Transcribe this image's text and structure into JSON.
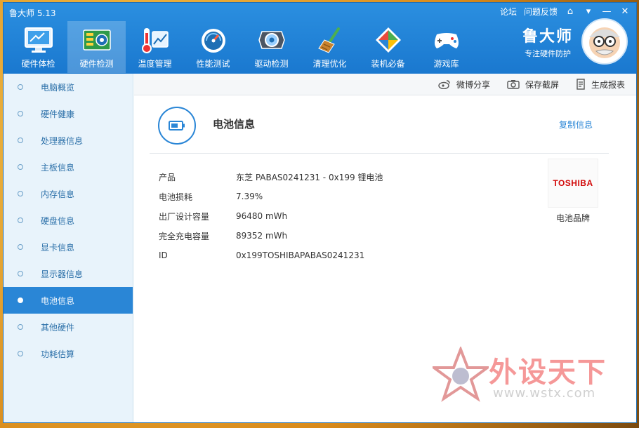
{
  "app": {
    "title": "鲁大师 5.13"
  },
  "window_links": {
    "forum": "论坛",
    "feedback": "问题反馈"
  },
  "toolbar": {
    "items": [
      {
        "label": "硬件体检",
        "icon": "monitor-icon"
      },
      {
        "label": "硬件检测",
        "icon": "circuit-board-icon",
        "active": true
      },
      {
        "label": "温度管理",
        "icon": "thermometer-icon"
      },
      {
        "label": "性能测试",
        "icon": "speedometer-icon"
      },
      {
        "label": "驱动检测",
        "icon": "gear-box-icon"
      },
      {
        "label": "清理优化",
        "icon": "broom-icon"
      },
      {
        "label": "装机必备",
        "icon": "install-cube-icon"
      },
      {
        "label": "游戏库",
        "icon": "gamepad-icon"
      }
    ]
  },
  "brand": {
    "name": "鲁大师",
    "slogan": "专注硬件防护"
  },
  "sidebar": {
    "items": [
      {
        "label": "电脑概览"
      },
      {
        "label": "硬件健康"
      },
      {
        "label": "处理器信息"
      },
      {
        "label": "主板信息"
      },
      {
        "label": "内存信息"
      },
      {
        "label": "硬盘信息"
      },
      {
        "label": "显卡信息"
      },
      {
        "label": "显示器信息"
      },
      {
        "label": "电池信息",
        "active": true
      },
      {
        "label": "其他硬件"
      },
      {
        "label": "功耗估算"
      }
    ]
  },
  "actions": {
    "share": "微博分享",
    "screenshot": "保存截屏",
    "report": "生成报表"
  },
  "section": {
    "title": "电池信息",
    "copy": "复制信息"
  },
  "info": {
    "rows": [
      {
        "key": "产品",
        "value": "东芝 PABAS0241231 - 0x199 锂电池"
      },
      {
        "key": "电池损耗",
        "value": "7.39%"
      },
      {
        "key": "出厂设计容量",
        "value": "96480 mWh"
      },
      {
        "key": "完全充电容量",
        "value": "89352 mWh"
      },
      {
        "key": "ID",
        "value": "0x199TOSHIBAPABAS0241231"
      }
    ]
  },
  "battery_brand": {
    "logo": "TOSHIBA",
    "caption": "电池品牌"
  },
  "watermark": {
    "text": "外设天下",
    "url": "www.wstx.com"
  },
  "colors": {
    "accent": "#2a86d6",
    "header": "#1a78cf",
    "logo_red": "#d20a0a"
  }
}
